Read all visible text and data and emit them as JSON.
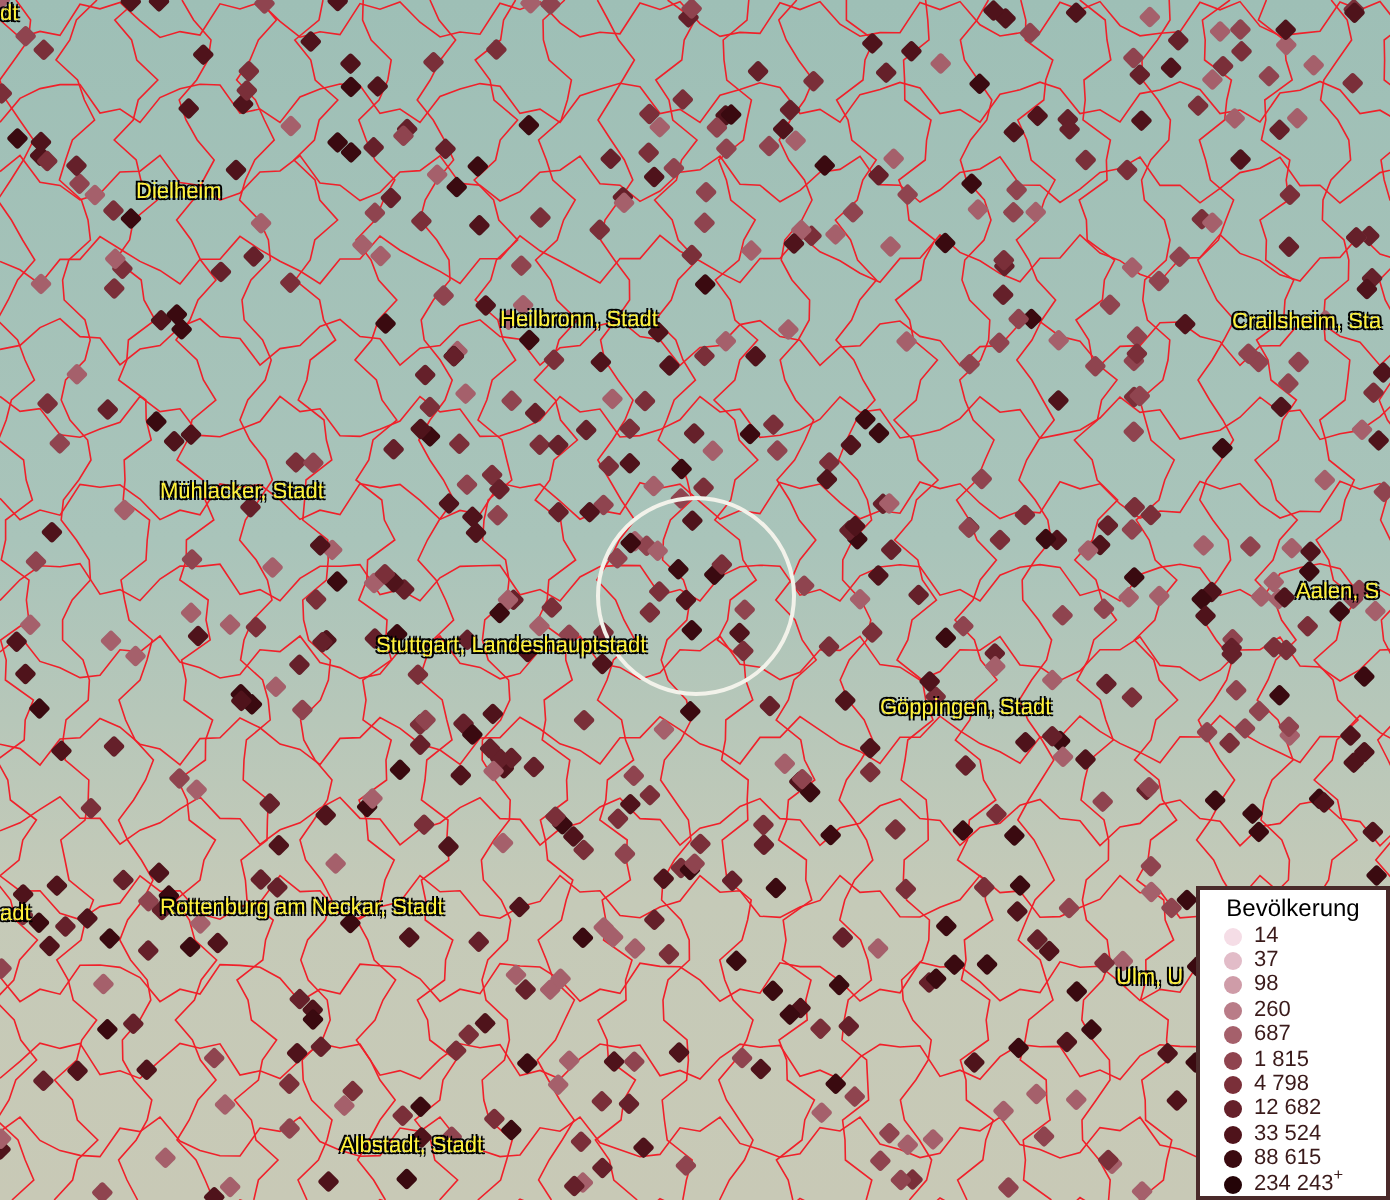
{
  "map": {
    "place_labels": [
      {
        "text": "dt"
      },
      {
        "text": "Dielheim"
      },
      {
        "text": "Heilbronn, Stadt"
      },
      {
        "text": "Crailsheim, Sta"
      },
      {
        "text": "Mühlacker, Stadt"
      },
      {
        "text": "Aalen, S"
      },
      {
        "text": "Stuttgart, Landeshauptstadt"
      },
      {
        "text": "Göppingen, Stadt"
      },
      {
        "text": "adt"
      },
      {
        "text": "Rottenburg am Neckar, Stadt"
      },
      {
        "text": "Ulm, U"
      },
      {
        "text": "Albstadt, Stadt"
      }
    ]
  },
  "legend": {
    "title": "Bevölkerung",
    "items": [
      {
        "label": "14",
        "color": "#f5dde6"
      },
      {
        "label": "37",
        "color": "#e2bcc8"
      },
      {
        "label": "98",
        "color": "#cf9ca8"
      },
      {
        "label": "260",
        "color": "#b97c88"
      },
      {
        "label": "687",
        "color": "#a5606b"
      },
      {
        "label": "1 815",
        "color": "#8f444f"
      },
      {
        "label": "4 798",
        "color": "#7a2f39"
      },
      {
        "label": "12 682",
        "color": "#65202a"
      },
      {
        "label": "33 524",
        "color": "#4f131b"
      },
      {
        "label": "88 615",
        "color": "#3a0a10"
      },
      {
        "label": "234 243$^{+}$",
        "color": "#240407"
      }
    ]
  }
}
